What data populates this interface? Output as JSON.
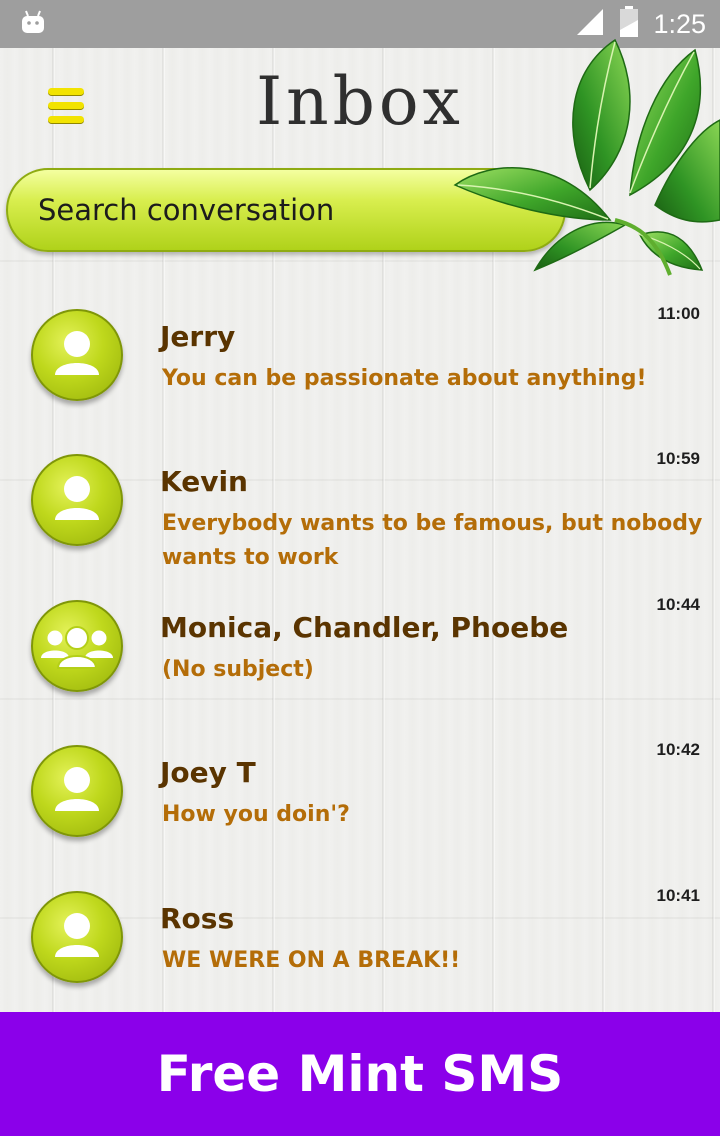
{
  "status_bar": {
    "time": "1:25"
  },
  "header": {
    "title": "Inbox",
    "menu_icon": "hamburger-menu-icon"
  },
  "search": {
    "placeholder": "Search conversation"
  },
  "colors": {
    "accent_green": "#c4dd2a",
    "name_brown": "#5a3400",
    "preview_orange": "#b46d08",
    "banner_purple": "#8b00ea"
  },
  "conversations": [
    {
      "name": "Jerry",
      "preview": " You can be passionate about anything!",
      "time": "11:00",
      "avatar_icon": "single-person-icon"
    },
    {
      "name": "Kevin",
      "preview": " Everybody wants to be famous, but nobody wants to work",
      "time": "10:59",
      "avatar_icon": "single-person-icon"
    },
    {
      "name": "Monica, Chandler, Phoebe",
      "preview": "(No subject)",
      "time": "10:44",
      "avatar_icon": "group-people-icon"
    },
    {
      "name": "Joey T",
      "preview": "How you doin'?",
      "time": "10:42",
      "avatar_icon": "single-person-icon"
    },
    {
      "name": "Ross",
      "preview": "WE WERE ON A BREAK!!",
      "time": "10:41",
      "avatar_icon": "single-person-icon"
    }
  ],
  "banner": {
    "text": "Free Mint SMS"
  }
}
